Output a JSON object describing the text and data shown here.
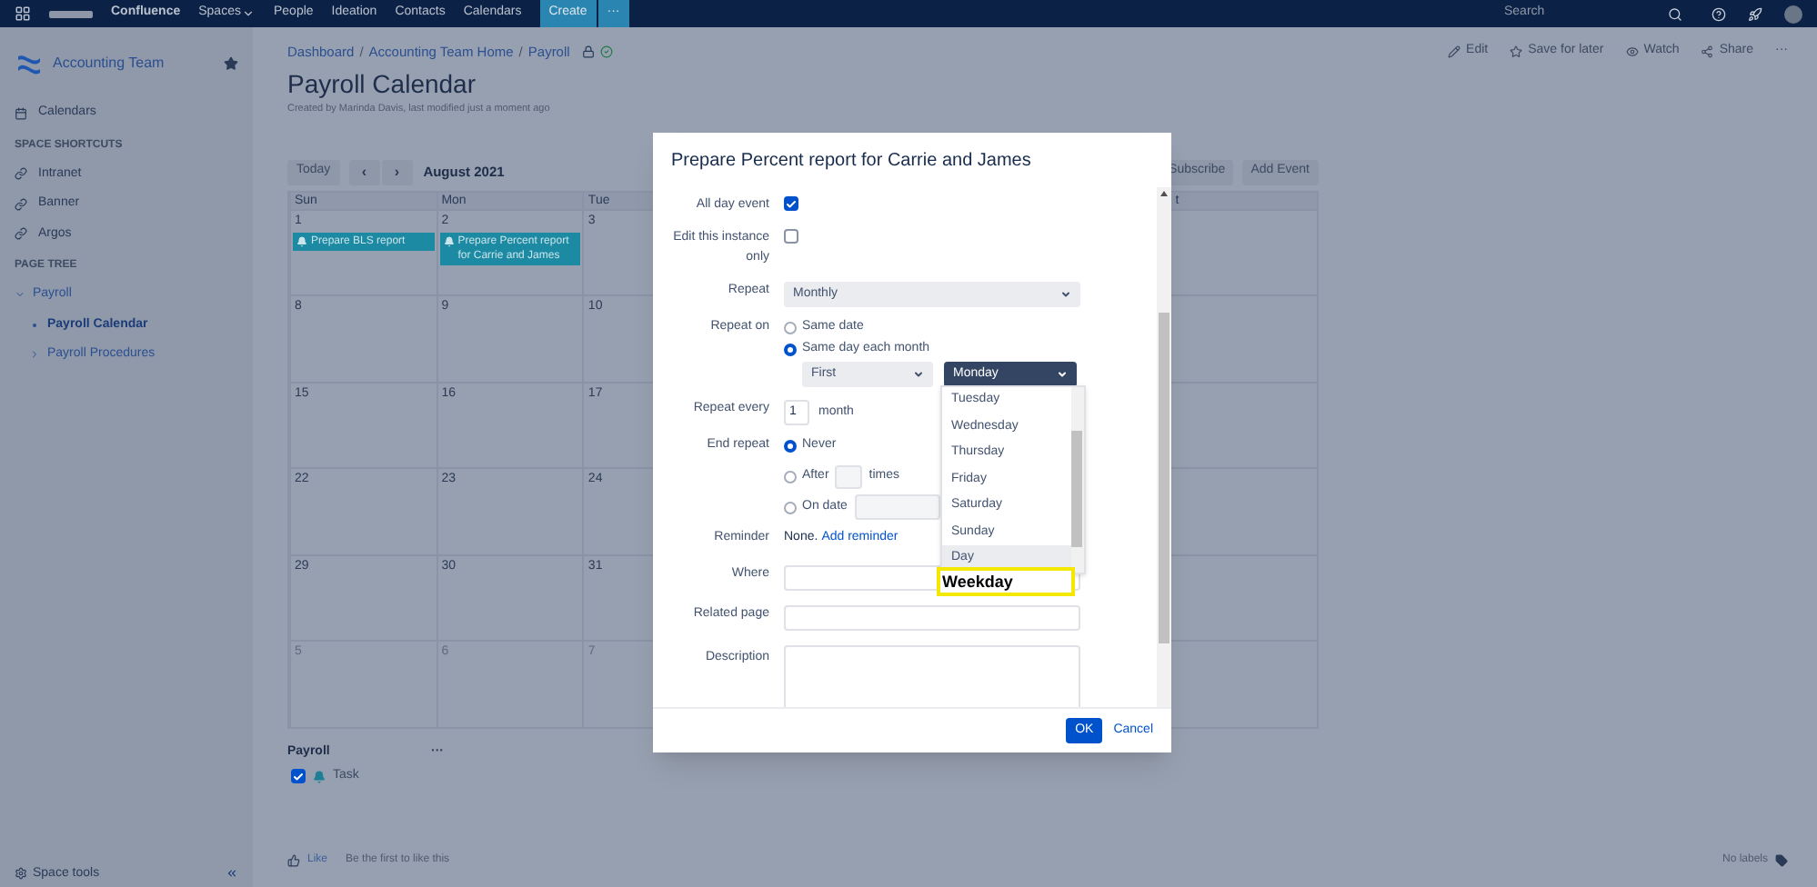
{
  "top_nav": {
    "product": "Confluence",
    "items": [
      {
        "label": "Spaces",
        "has_menu": true
      },
      {
        "label": "People",
        "has_menu": false
      },
      {
        "label": "Ideation",
        "has_menu": false
      },
      {
        "label": "Contacts",
        "has_menu": false
      },
      {
        "label": "Calendars",
        "has_menu": false
      }
    ],
    "create_button": "Create",
    "more_button": "···",
    "search": {
      "placeholder": "Search"
    }
  },
  "sidebar": {
    "space_name": "Accounting Team",
    "starred": true,
    "calendars_link": "Calendars",
    "shortcuts_heading": "SPACE SHORTCUTS",
    "shortcuts": [
      "Intranet",
      "Banner",
      "Argos"
    ],
    "tree_heading": "PAGE TREE",
    "tree": [
      {
        "label": "Payroll",
        "expanded": true,
        "current": false,
        "children": [
          {
            "label": "Payroll Calendar",
            "current": true
          },
          {
            "label": "Payroll Procedures",
            "current": false,
            "expanded": false
          }
        ]
      }
    ],
    "space_tools": "Space tools"
  },
  "breadcrumbs": [
    "Dashboard",
    "Accounting Team Home",
    "Payroll"
  ],
  "breadcrumb_separator": "/",
  "page_actions": [
    "Edit",
    "Save for later",
    "Watch",
    "Share",
    "···"
  ],
  "page": {
    "title": "Payroll Calendar",
    "byline": "Created by Marinda Davis, last modified just a moment ago"
  },
  "calendar_toolbar": {
    "today": "Today",
    "prev": "‹",
    "next": "›",
    "month": "August 2021",
    "subscribe": "Subscribe",
    "add_event": "Add Event"
  },
  "calendar": {
    "headers": [
      "Sun",
      "Mon",
      "Tue"
    ],
    "partial_header": "t",
    "weeks": [
      {
        "days": [
          {
            "number": "1",
            "other_month": false,
            "events": [
              "Prepare BLS report"
            ]
          },
          {
            "number": "2",
            "other_month": false,
            "events": [
              "Prepare Percent report for Carrie and James"
            ]
          },
          {
            "number": "3",
            "other_month": false
          }
        ]
      },
      {
        "days": [
          {
            "number": "8",
            "other_month": false
          },
          {
            "number": "9",
            "other_month": false
          },
          {
            "number": "10",
            "other_month": false
          }
        ]
      },
      {
        "days": [
          {
            "number": "15",
            "other_month": false
          },
          {
            "number": "16",
            "other_month": false
          },
          {
            "number": "17",
            "other_month": false
          }
        ]
      },
      {
        "days": [
          {
            "number": "22",
            "other_month": false
          },
          {
            "number": "23",
            "other_month": false
          },
          {
            "number": "24",
            "other_month": false
          }
        ]
      },
      {
        "days": [
          {
            "number": "29",
            "other_month": false
          },
          {
            "number": "30",
            "other_month": false
          },
          {
            "number": "31",
            "other_month": false
          }
        ]
      },
      {
        "days": [
          {
            "number": "5",
            "other_month": true
          },
          {
            "number": "6",
            "other_month": true
          },
          {
            "number": "7",
            "other_month": true
          }
        ]
      }
    ]
  },
  "calendar_legend": {
    "title": "Payroll",
    "more": "···",
    "items": [
      {
        "label": "Task",
        "checked": true
      }
    ]
  },
  "footer": {
    "like": "Like",
    "like_note": "Be the first to like this",
    "labels": "No labels"
  },
  "dialog": {
    "title": "Prepare Percent report for Carrie and James",
    "all_day": {
      "label": "All day event",
      "checked": true
    },
    "edit_instance": {
      "label": "Edit this instance only",
      "checked": false
    },
    "repeat": {
      "label": "Repeat",
      "value": "Monthly"
    },
    "repeat_on": {
      "label": "Repeat on",
      "options": [
        {
          "label": "Same date",
          "selected": false
        },
        {
          "label": "Same day each month",
          "selected": true
        }
      ],
      "ordinal": "First",
      "weekday": {
        "value": "Monday",
        "open": true
      }
    },
    "repeat_every": {
      "label": "Repeat every",
      "value": "1",
      "unit": "month"
    },
    "end_repeat": {
      "label": "End repeat",
      "options": [
        {
          "kind": "plain",
          "label": "Never",
          "selected": true
        },
        {
          "kind": "count",
          "label": "After",
          "suffix": "times",
          "selected": false
        },
        {
          "kind": "date",
          "label": "On date",
          "selected": false
        }
      ]
    },
    "reminder": {
      "label": "Reminder",
      "value": "None.",
      "link": "Add reminder"
    },
    "where": {
      "label": "Where"
    },
    "related_page": {
      "label": "Related page"
    },
    "description": {
      "label": "Description"
    },
    "weekday_options": [
      {
        "label": "Tuesday",
        "highlighted": false
      },
      {
        "label": "Wednesday",
        "highlighted": false
      },
      {
        "label": "Thursday",
        "highlighted": false
      },
      {
        "label": "Friday",
        "highlighted": false
      },
      {
        "label": "Saturday",
        "highlighted": false
      },
      {
        "label": "Sunday",
        "highlighted": false
      },
      {
        "label": "Day",
        "highlighted": true
      }
    ],
    "callout": "Weekday",
    "ok": "OK",
    "cancel": "Cancel"
  }
}
